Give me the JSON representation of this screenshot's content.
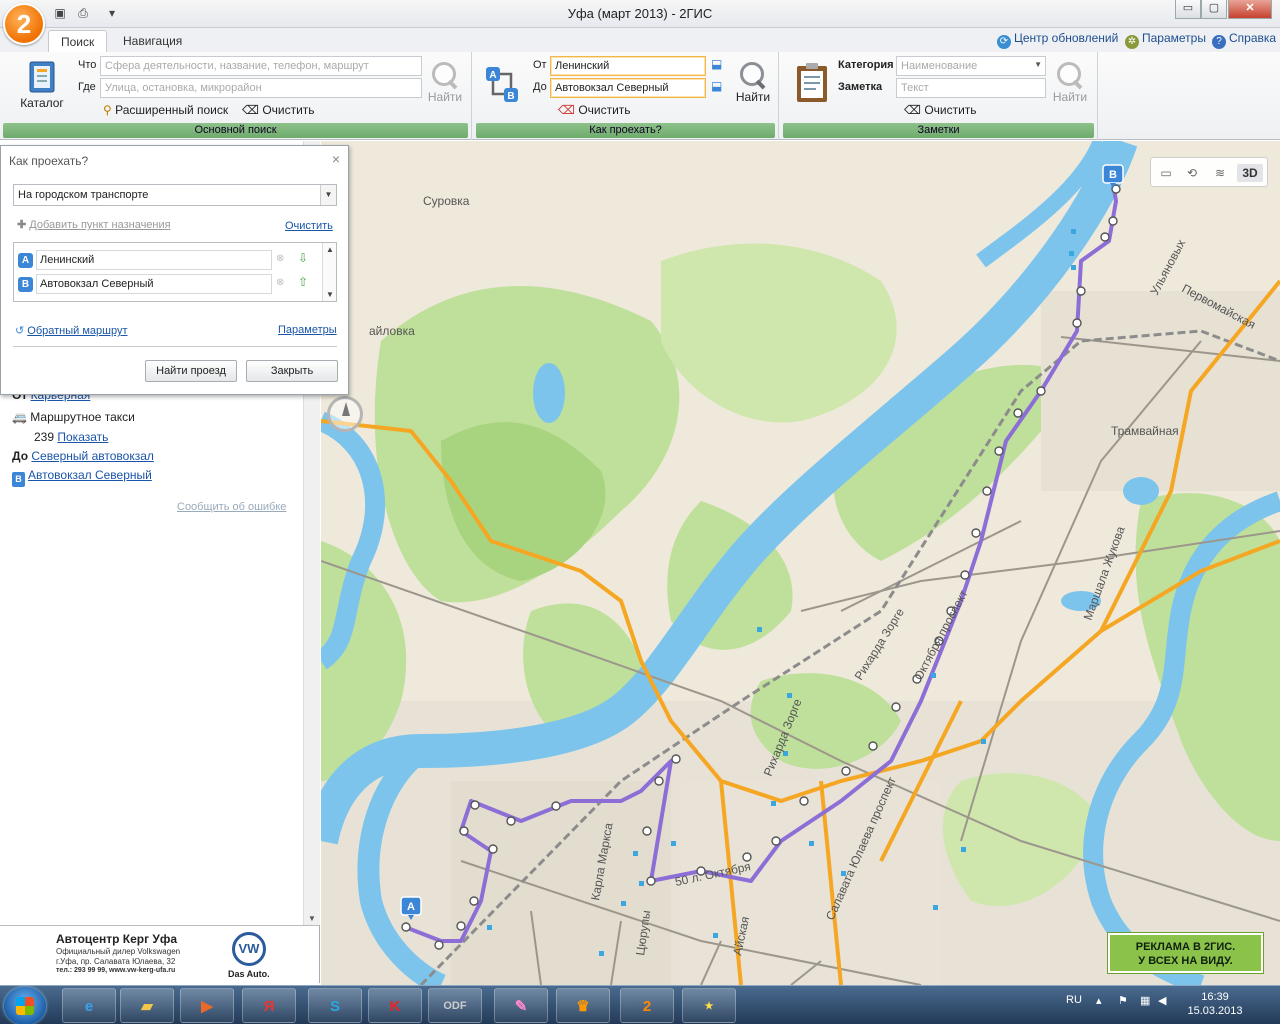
{
  "window": {
    "title": "Уфа (март 2013) - 2ГИС",
    "logo": "2",
    "minimize": "▭",
    "maximize": "▢",
    "close": "✕"
  },
  "tabs": [
    "Поиск",
    "Навигация"
  ],
  "toplinks": {
    "update_center": "Центр обновлений",
    "settings": "Параметры",
    "help": "Справка"
  },
  "search_group": {
    "catalog": "Каталог",
    "what_label": "Что",
    "what_placeholder": "Сфера деятельности, название, телефон, маршрут",
    "where_label": "Где",
    "where_placeholder": "Улица, остановка, микрорайон",
    "advanced": "Расширенный поиск",
    "clear": "Очистить",
    "find": "Найти",
    "caption": "Основной поиск"
  },
  "route_group": {
    "from_label": "От",
    "from_value": "Ленинский",
    "to_label": "До",
    "to_value": "Автовокзал Северный",
    "clear": "Очистить",
    "find": "Найти",
    "caption": "Как проехать?"
  },
  "notes_group": {
    "category_label": "Категория",
    "category_placeholder": "Наименование",
    "note_label": "Заметка",
    "note_placeholder": "Текст",
    "clear": "Очистить",
    "find": "Найти",
    "caption": "Заметки"
  },
  "dialog": {
    "title": "Как проехать?",
    "close": "×",
    "mode": "На городском транспорте",
    "add_point": "Добавить пункт назначения",
    "clear": "Очистить",
    "point_a_badge": "A",
    "point_a": "Ленинский",
    "point_b_badge": "B",
    "point_b": "Автовокзал Северный",
    "reverse": "Обратный маршрут",
    "params": "Параметры",
    "find_btn": "Найти проезд",
    "close_btn": "Закрыть"
  },
  "route_info": {
    "from_label": "От",
    "from_stop": "Карьерная",
    "transport": "Маршрутное такси",
    "route_number": "239",
    "show": "Показать",
    "to_label": "До",
    "to_stop": "Северный автовокзал",
    "to_place": "Автовокзал Северный",
    "report": "Сообщить об ошибке"
  },
  "ad": {
    "title": "Автоцентр Керг Уфа",
    "line1": "Официальный дилер Volkswagen",
    "line2": "г.Уфа, пр. Салавата Юлаева, 32",
    "line3": "тел.: 293 99 99, www.vw-kerg-ufa.ru",
    "brand": "Das Auto."
  },
  "map": {
    "labels": {
      "surovka": "Суровка",
      "mikhailovka": "айловка",
      "ulyanovykh": "Ульяновых",
      "pervomayskaya": "Первомайская",
      "tramvaynaya": "Трамвайная",
      "marshala_zhukova": "Маршала Жукова",
      "rikharda_zorge": "Рихарда Зорге",
      "oktyabrya_prospekt": "Октября проспект",
      "rikharda_zorge2": "Рихарда Зорге",
      "salavata_yulaeva": "Салавата Юлаева проспект",
      "karla_marksa": "Карла Маркса",
      "aiskaya": "Айская",
      "tsyurupy": "Цюрупы",
      "let_oktyabrya": "50 л. Октября"
    },
    "marker_a": "A",
    "marker_b": "B",
    "tool_3d": "3D",
    "ad_line1": "РЕКЛАМА В 2ГИС.",
    "ad_line2": "У ВСЕХ НА ВИДУ.",
    "colors": {
      "water": "#7cc4ec",
      "forest": "#bfe09a",
      "land": "#efe9db",
      "road": "#f5a623",
      "route": "#8d6ed6"
    }
  },
  "taskbar": {
    "lang": "RU",
    "time": "16:39",
    "date": "15.03.2013"
  }
}
